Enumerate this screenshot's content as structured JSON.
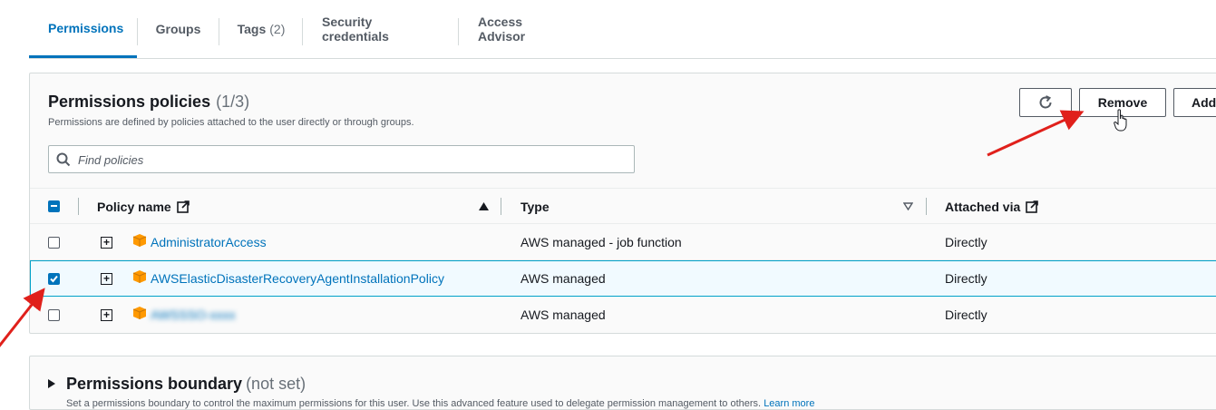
{
  "tabs": [
    {
      "label": "Permissions",
      "active": true
    },
    {
      "label": "Groups"
    },
    {
      "label": "Tags",
      "count": "(2)"
    },
    {
      "label": "Security credentials"
    },
    {
      "label": "Access Advisor"
    }
  ],
  "policies": {
    "title": "Permissions policies",
    "count": "(1/3)",
    "description": "Permissions are defined by policies attached to the user directly or through groups.",
    "refresh_icon": "refresh-icon",
    "remove_label": "Remove",
    "add_label": "Add",
    "search_placeholder": "Find policies",
    "columns": {
      "policy_name": "Policy name",
      "type": "Type",
      "attached_via": "Attached via"
    },
    "rows": [
      {
        "name": "AdministratorAccess",
        "type": "AWS managed - job function",
        "attached": "Directly",
        "selected": false
      },
      {
        "name": "AWSElasticDisasterRecoveryAgentInstallationPolicy",
        "type": "AWS managed",
        "attached": "Directly",
        "selected": true
      },
      {
        "name": "AWSSSO-xxxx",
        "type": "AWS managed",
        "attached": "Directly",
        "selected": false,
        "redacted": true
      }
    ]
  },
  "boundary": {
    "title": "Permissions boundary",
    "status": "(not set)",
    "description": "Set a permissions boundary to control the maximum permissions for this user. Use this advanced feature used to delegate permission management to others.",
    "learn_more": "Learn more"
  },
  "colors": {
    "accent": "#0073bb",
    "annotation_arrow": "#e0201b",
    "policy_icon": "#f90"
  }
}
